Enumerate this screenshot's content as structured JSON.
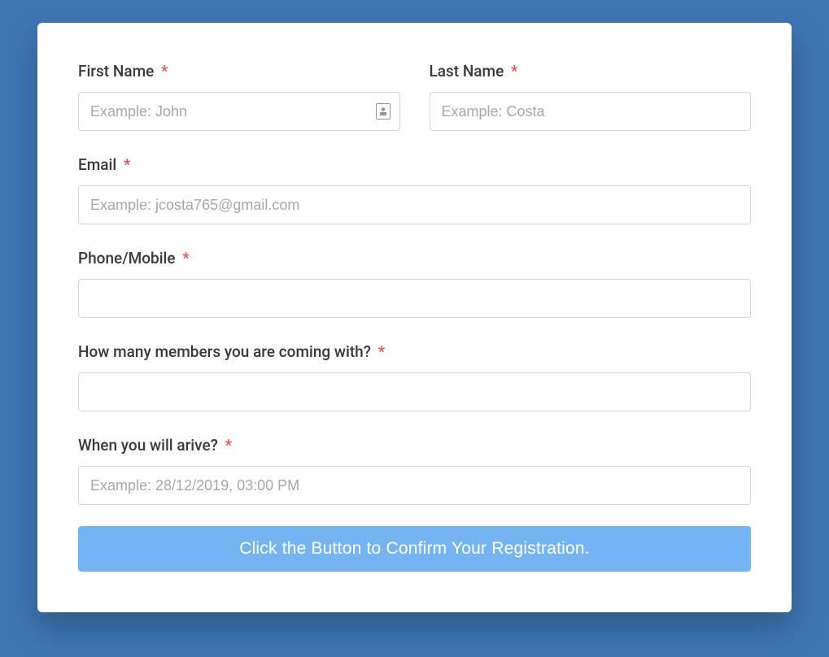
{
  "colors": {
    "page_bg": "#3e76b4",
    "card_bg": "#ffffff",
    "input_border": "#d6d6d6",
    "placeholder": "#a8a8a8",
    "label": "#3a3a3a",
    "required": "#e55353",
    "button_bg": "#75b4f3",
    "button_text": "#ffffff"
  },
  "form": {
    "first_name": {
      "label": "First Name",
      "placeholder": "Example: John",
      "value": ""
    },
    "last_name": {
      "label": "Last Name",
      "placeholder": "Example: Costa",
      "value": ""
    },
    "email": {
      "label": "Email",
      "placeholder": "Example: jcosta765@gmail.com",
      "value": ""
    },
    "phone": {
      "label": "Phone/Mobile",
      "placeholder": "",
      "value": ""
    },
    "members": {
      "label": "How many members you are coming with?",
      "placeholder": "",
      "value": ""
    },
    "arrival": {
      "label": "When you will arive?",
      "placeholder": "Example: 28/12/2019, 03:00 PM",
      "value": ""
    },
    "submit_label": "Click the Button to Confirm Your Registration."
  }
}
